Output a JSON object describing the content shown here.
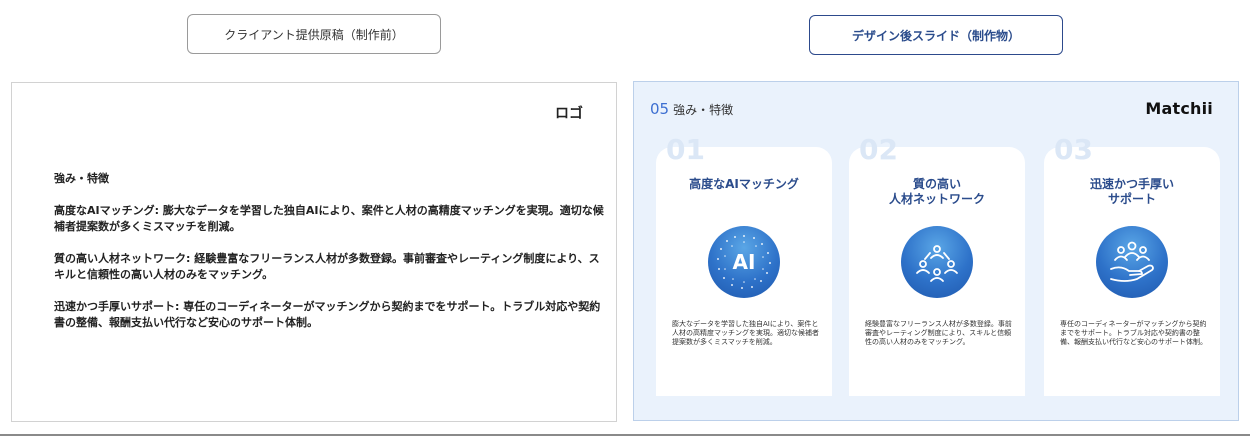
{
  "labels": {
    "before": "クライアント提供原稿（制作前）",
    "after": "デザイン後スライド（制作物）"
  },
  "before_doc": {
    "logo_placeholder": "ロゴ",
    "heading": "強み・特徴",
    "paragraphs": [
      "高度なAIマッチング: 膨大なデータを学習した独自AIにより、案件と人材の高精度マッチングを実現。適切な候補者提案数が多くミスマッチを削減。",
      "質の高い人材ネットワーク: 経験豊富なフリーランス人材が多数登録。事前審査やレーティング制度により、スキルと信頼性の高い人材のみをマッチング。",
      "迅速かつ手厚いサポート: 専任のコーディネーターがマッチングから契約までをサポート。トラブル対応や契約書の整備、報酬支払い代行など安心のサポート体制。"
    ]
  },
  "slide": {
    "number": "05",
    "title": "強み・特徴",
    "brand": "Matchii",
    "cards": [
      {
        "num": "01",
        "title": "高度なAIマッチング",
        "icon_text": "AI",
        "icon": "ai-sphere-icon",
        "desc": "膨大なデータを学習した独自AIにより、案件と人材の高精度マッチングを実現。適切な候補者提案数が多くミスマッチを削減。"
      },
      {
        "num": "02",
        "title": "質の高い\n人材ネットワーク",
        "icon": "people-network-icon",
        "desc": "経験豊富なフリーランス人材が多数登録。事前審査やレーティング制度により、スキルと信頼性の高い人材のみをマッチング。"
      },
      {
        "num": "03",
        "title": "迅速かつ手厚い\nサポート",
        "icon": "hand-support-icon",
        "desc": "専任のコーディネーターがマッチングから契約までをサポート。トラブル対応や契約書の整備、報酬支払い代行など安心のサポート体制。"
      }
    ]
  },
  "colors": {
    "accent": "#2b4c8c",
    "slide_bg": "#eaf2fc",
    "icon_blue": "#2e72c9"
  }
}
